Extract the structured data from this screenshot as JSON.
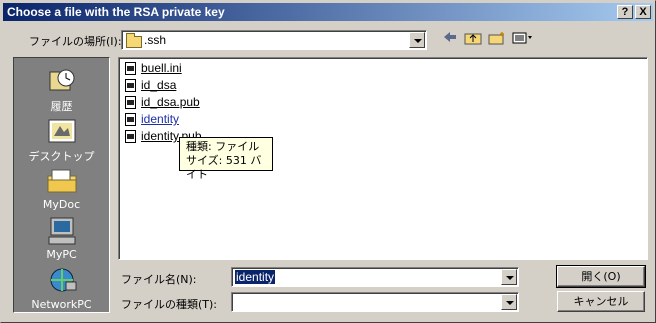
{
  "window": {
    "title": "Choose a file with the RSA private key",
    "help_label": "?",
    "close_label": "X"
  },
  "lookin": {
    "label": "ファイルの場所(I):",
    "value": ".ssh"
  },
  "toolbar": {
    "back_icon": "back-arrow-icon",
    "up_icon": "up-folder-icon",
    "newfolder_icon": "new-folder-icon",
    "view_icon": "view-menu-icon"
  },
  "places": [
    {
      "label": "履歴",
      "icon": "history-icon"
    },
    {
      "label": "デスクトップ",
      "icon": "desktop-icon"
    },
    {
      "label": "MyDoc",
      "icon": "my-documents-icon"
    },
    {
      "label": "MyPC",
      "icon": "my-computer-icon"
    },
    {
      "label": "NetworkPC",
      "icon": "network-icon"
    }
  ],
  "files": [
    {
      "name": "buell.ini"
    },
    {
      "name": "id_dsa"
    },
    {
      "name": "id_dsa.pub"
    },
    {
      "name": "identity"
    },
    {
      "name": "identity.pub"
    }
  ],
  "tooltip": {
    "line1": "種類: ファイル",
    "line2": "サイズ: 531 バイト"
  },
  "filename": {
    "label": "ファイル名(N):",
    "value": "identity"
  },
  "filetype": {
    "label": "ファイルの種類(T):",
    "value": ""
  },
  "buttons": {
    "open": "開く(O)",
    "cancel": "キャンセル"
  }
}
